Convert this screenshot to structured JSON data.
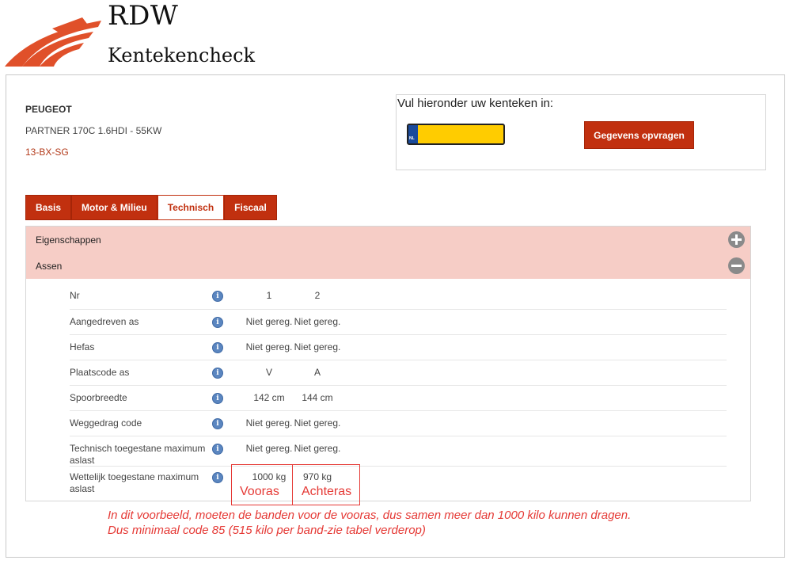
{
  "header": {
    "brand": "RDW",
    "subtitle": "Kentekencheck"
  },
  "vehicle": {
    "make": "PEUGEOT",
    "model": "PARTNER 170C 1.6HDI - 55KW",
    "plate": "13-BX-SG"
  },
  "lookup": {
    "label": "Vul hieronder uw kenteken in:",
    "plate_value": "",
    "plate_country": "NL",
    "button_label": "Gegevens opvragen"
  },
  "tabs": [
    {
      "label": "Basis",
      "active": false
    },
    {
      "label": "Motor & Milieu",
      "active": false
    },
    {
      "label": "Technisch",
      "active": true
    },
    {
      "label": "Fiscaal",
      "active": false
    }
  ],
  "sections": {
    "eigenschappen": {
      "title": "Eigenschappen",
      "state": "collapsed",
      "icon": "plus-icon"
    },
    "assen": {
      "title": "Assen",
      "state": "expanded",
      "icon": "minus-icon"
    }
  },
  "axle_rows": [
    {
      "label": "Nr",
      "v1": "1",
      "v2": "2"
    },
    {
      "label": "Aangedreven as",
      "v1": "Niet gereg.",
      "v2": "Niet gereg."
    },
    {
      "label": "Hefas",
      "v1": "Niet gereg.",
      "v2": "Niet gereg."
    },
    {
      "label": "Plaatscode as",
      "v1": "V",
      "v2": "A"
    },
    {
      "label": "Spoorbreedte",
      "v1": "142 cm",
      "v2": "144 cm"
    },
    {
      "label": "Weggedrag code",
      "v1": "Niet gereg.",
      "v2": "Niet gereg."
    },
    {
      "label": "Technisch toegestane maximum aslast",
      "v1": "Niet gereg.",
      "v2": "Niet gereg."
    },
    {
      "label": "Wettelijk toegestane maximum aslast",
      "v1": "1000 kg",
      "v2": "970 kg"
    }
  ],
  "annotations": {
    "front_tag": "Vooras",
    "rear_tag": "Achteras",
    "note_line1": "In dit voorbeeld, moeten de banden voor de vooras, dus samen meer dan 1000 kilo kunnen dragen.",
    "note_line2": "Dus minimaal code 85 (515 kilo per band-zie tabel verderop)"
  },
  "colors": {
    "accent": "#c1300f",
    "section_bg": "#f6cdc6",
    "annotation": "#e53935",
    "plate_yellow": "#ffcc00",
    "info_blue": "#5b86c0"
  }
}
